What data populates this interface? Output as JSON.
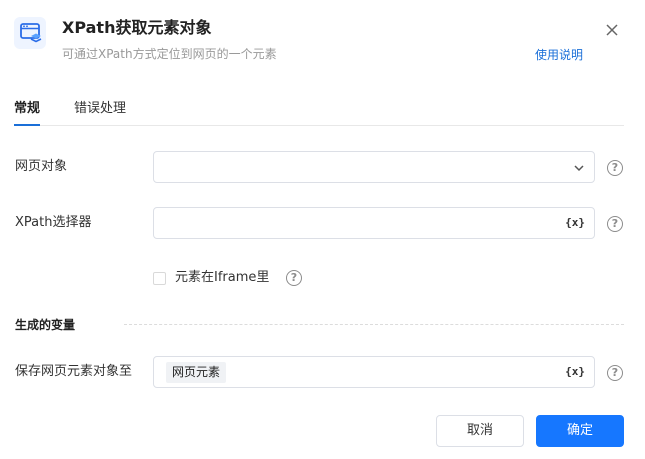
{
  "dialog": {
    "title": "XPath获取元素对象",
    "subtitle": "可通过XPath方式定位到网页的一个元素",
    "help_link": "使用说明",
    "icon": "webpage-element-icon",
    "close_icon": "close-icon"
  },
  "tabs": [
    {
      "label": "常规",
      "active": true
    },
    {
      "label": "错误处理",
      "active": false
    }
  ],
  "fields": {
    "web_object": {
      "label": "网页对象",
      "value": "",
      "icon": "chevron-down-icon"
    },
    "xpath_selector": {
      "label": "XPath选择器",
      "value": "",
      "icon": "variable-icon",
      "icon_text": "{x}"
    },
    "iframe_checkbox": {
      "label": "元素在Iframe里",
      "checked": false
    }
  },
  "output_section": {
    "title": "生成的变量",
    "save_field": {
      "label": "保存网页元素对象至",
      "tag": "网页元素",
      "icon": "variable-icon",
      "icon_text": "{x}"
    }
  },
  "help_icon_text": "?",
  "buttons": {
    "cancel": "取消",
    "ok": "确定"
  },
  "colors": {
    "primary": "#1677ff",
    "link": "#1a6fd8",
    "border": "#dcdfe6"
  }
}
